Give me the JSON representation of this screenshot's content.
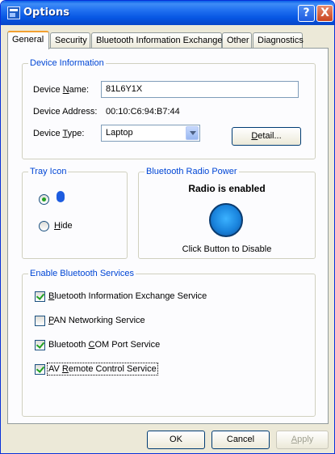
{
  "window": {
    "title": "Options",
    "help_label": "?",
    "close_label": "X"
  },
  "tabs": [
    {
      "label": "General"
    },
    {
      "label": "Security"
    },
    {
      "label": "Bluetooth Information Exchanger"
    },
    {
      "label": "Other"
    },
    {
      "label": "Diagnostics"
    }
  ],
  "device_info": {
    "title": "Device Information",
    "name_label_pre": "Device ",
    "name_label_u": "N",
    "name_label_post": "ame:",
    "name_value": "81L6Y1X",
    "address_label": "Device Address:",
    "address_value": "00:10:C6:94:B7:44",
    "type_label_pre": "Device ",
    "type_label_u": "T",
    "type_label_post": "ype:",
    "type_value": "Laptop",
    "detail_pre": "",
    "detail_u": "D",
    "detail_post": "etail..."
  },
  "tray_icon": {
    "title": "Tray Icon",
    "hide_u": "H",
    "hide_post": "ide",
    "selected": "bluetooth-icon"
  },
  "radio_power": {
    "title": "Bluetooth Radio Power",
    "status": "Radio is enabled",
    "hint": "Click Button to Disable"
  },
  "services": {
    "title": "Enable Bluetooth Services",
    "items": [
      {
        "pre": "",
        "u": "B",
        "post": "luetooth Information Exchange Service",
        "checked": true
      },
      {
        "pre": "",
        "u": "P",
        "post": "AN Networking Service",
        "checked": false
      },
      {
        "pre": "Bluetooth ",
        "u": "C",
        "post": "OM Port Service",
        "checked": true
      },
      {
        "pre": "AV ",
        "u": "R",
        "post": "emote Control Service",
        "checked": true
      }
    ]
  },
  "buttons": {
    "ok": "OK",
    "cancel": "Cancel",
    "apply_u": "A",
    "apply_post": "pply"
  }
}
